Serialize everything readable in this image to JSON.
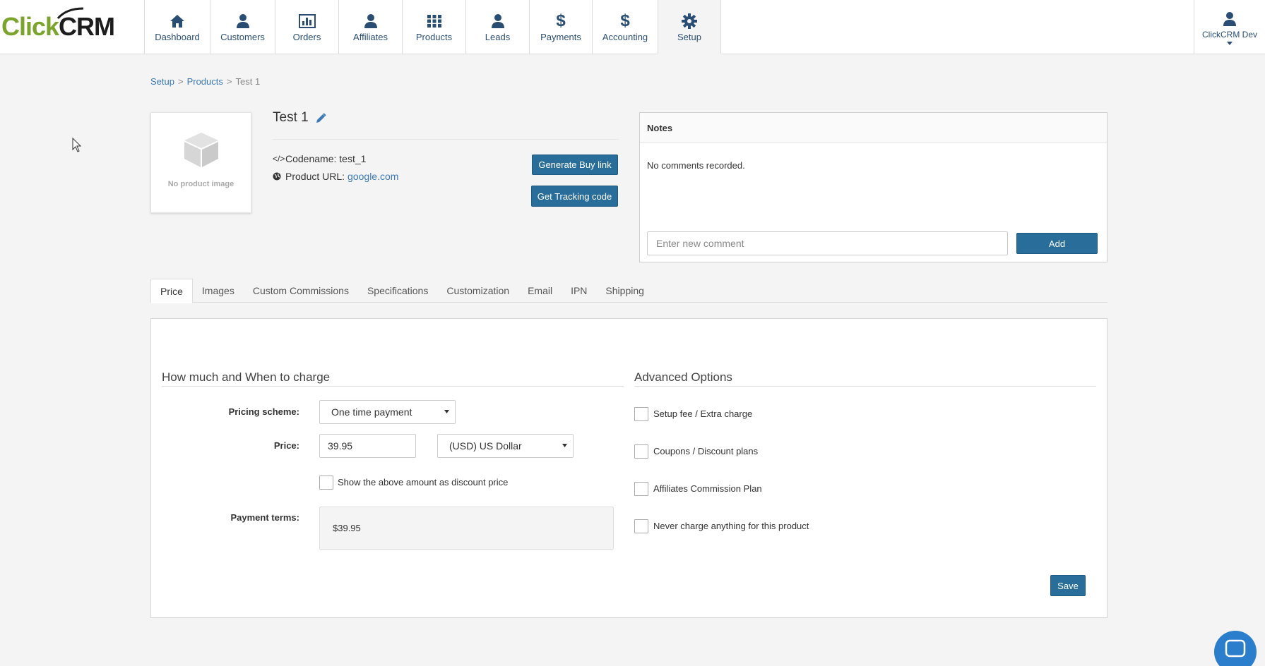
{
  "brand": {
    "logo_click": "Click",
    "logo_crm": "CRM"
  },
  "nav": {
    "items": [
      {
        "label": "Dashboard",
        "icon": "home-icon"
      },
      {
        "label": "Customers",
        "icon": "person-icon"
      },
      {
        "label": "Orders",
        "icon": "bar-chart-icon"
      },
      {
        "label": "Affiliates",
        "icon": "person-icon"
      },
      {
        "label": "Products",
        "icon": "grid-icon"
      },
      {
        "label": "Leads",
        "icon": "person-icon"
      },
      {
        "label": "Payments",
        "icon": "dollar-icon"
      },
      {
        "label": "Accounting",
        "icon": "dollar-icon"
      },
      {
        "label": "Setup",
        "icon": "gear-icon"
      }
    ],
    "active": "Setup",
    "user": "ClickCRM Dev"
  },
  "breadcrumb": {
    "setup": "Setup",
    "products": "Products",
    "current": "Test 1",
    "separator": ">"
  },
  "product": {
    "no_image": "No product image",
    "title": "Test 1",
    "codename_label": "Codename:",
    "codename": "test_1",
    "url_label": "Product URL:",
    "url": "google.com",
    "buy_link_label": "Generate Buy link",
    "tracking_label": "Get Tracking code"
  },
  "notes": {
    "title": "Notes",
    "empty": "No comments recorded.",
    "placeholder": "Enter new comment",
    "add_label": "Add"
  },
  "tabs": [
    {
      "label": "Price"
    },
    {
      "label": "Images"
    },
    {
      "label": "Custom Commissions"
    },
    {
      "label": "Specifications"
    },
    {
      "label": "Customization"
    },
    {
      "label": "Email"
    },
    {
      "label": "IPN"
    },
    {
      "label": "Shipping"
    }
  ],
  "price": {
    "section_left": "How much and When to charge",
    "section_right": "Advanced Options",
    "pricing_scheme_label": "Pricing scheme:",
    "pricing_scheme_value": "One time payment",
    "price_label": "Price:",
    "price_value": "39.95",
    "currency_value": "(USD) US Dollar",
    "discount_label": "Show the above amount as discount price",
    "terms_label": "Payment terms:",
    "terms_value": "$39.95",
    "options": [
      {
        "label": "Setup fee / Extra charge"
      },
      {
        "label": "Coupons / Discount plans"
      },
      {
        "label": "Affiliates Commission Plan"
      },
      {
        "label": "Never charge anything for this product"
      }
    ],
    "save_label": "Save"
  },
  "colors": {
    "accent": "#296d9a",
    "nav_text": "#2a4e73",
    "link": "#3b7ab5",
    "logo_green": "#7aa42c"
  }
}
